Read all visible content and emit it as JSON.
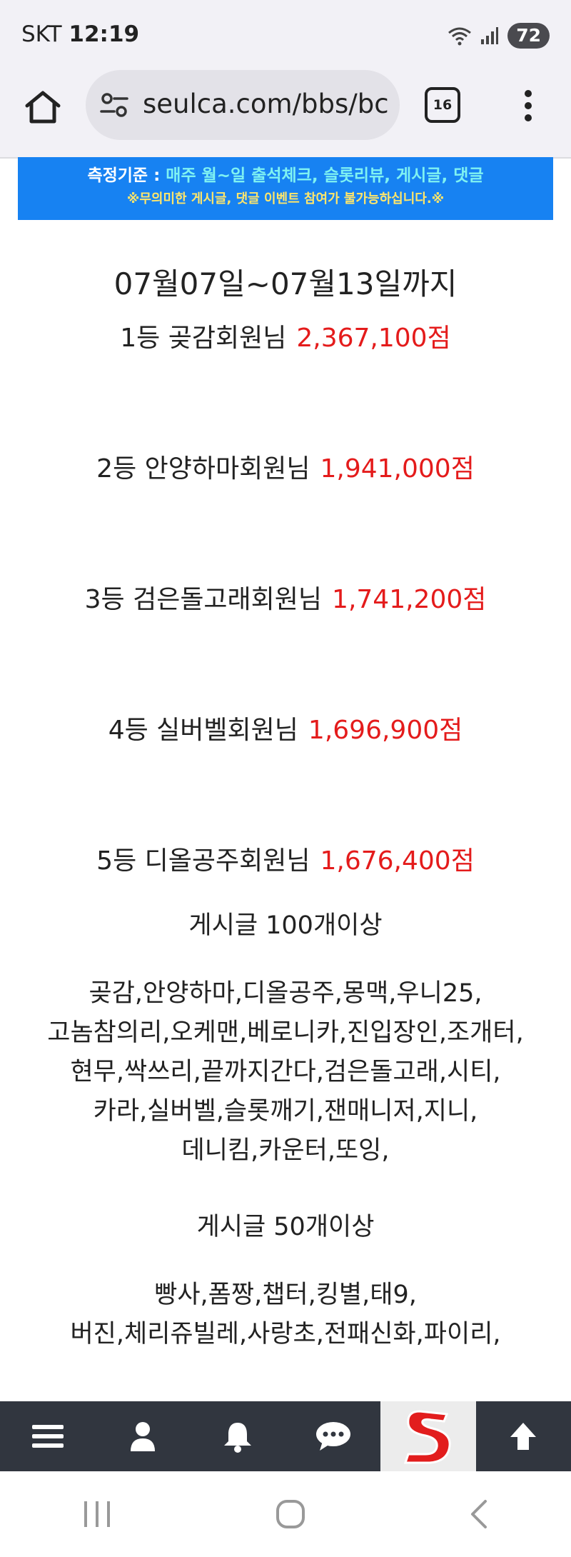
{
  "status_bar": {
    "carrier": "SKT",
    "time": "12:19",
    "battery": "72"
  },
  "browser": {
    "url": "seulca.com/bbs/bc",
    "tab_count": "16"
  },
  "banner": {
    "label": "측정기준 : ",
    "criteria": "매주 월~일 출석체크, 슬롯리뷰, 게시글, 댓글",
    "notice": "※무의미한 게시글, 댓글 이벤트 참여가 불가능하십니다.※"
  },
  "period": "07월07일~07월13일까지",
  "rankings": [
    {
      "rank": "1등 곶감회원님",
      "score": "2,367,100점"
    },
    {
      "rank": "2등 안양하마회원님",
      "score": "1,941,000점"
    },
    {
      "rank": "3등 검은돌고래회원님",
      "score": "1,741,200점"
    },
    {
      "rank": "4등 실버벨회원님",
      "score": "1,696,900점"
    },
    {
      "rank": "5등 디올공주회원님",
      "score": "1,676,400점"
    }
  ],
  "sections": [
    {
      "title": "게시글 100개이상",
      "lines": [
        "곶감,안양하마,디올공주,몽맥,우니25,",
        "고놈참의리,오케맨,베로니카,진입장인,조개터,",
        "현무,싹쓰리,끝까지간다,검은돌고래,시티,",
        "카라,실버벨,슬롯깨기,잰매니저,지니,",
        "데니킴,카운터,또잉,"
      ]
    },
    {
      "title": "게시글 50개이상",
      "lines": [
        "빵사,폼짱,챕터,킹별,태9,",
        "버진,체리쥬빌레,사랑초,전패신화,파이리,"
      ]
    }
  ],
  "colors": {
    "score": "#e41b1b",
    "banner_bg": "#1782f2",
    "nav_bg": "#31363f"
  }
}
